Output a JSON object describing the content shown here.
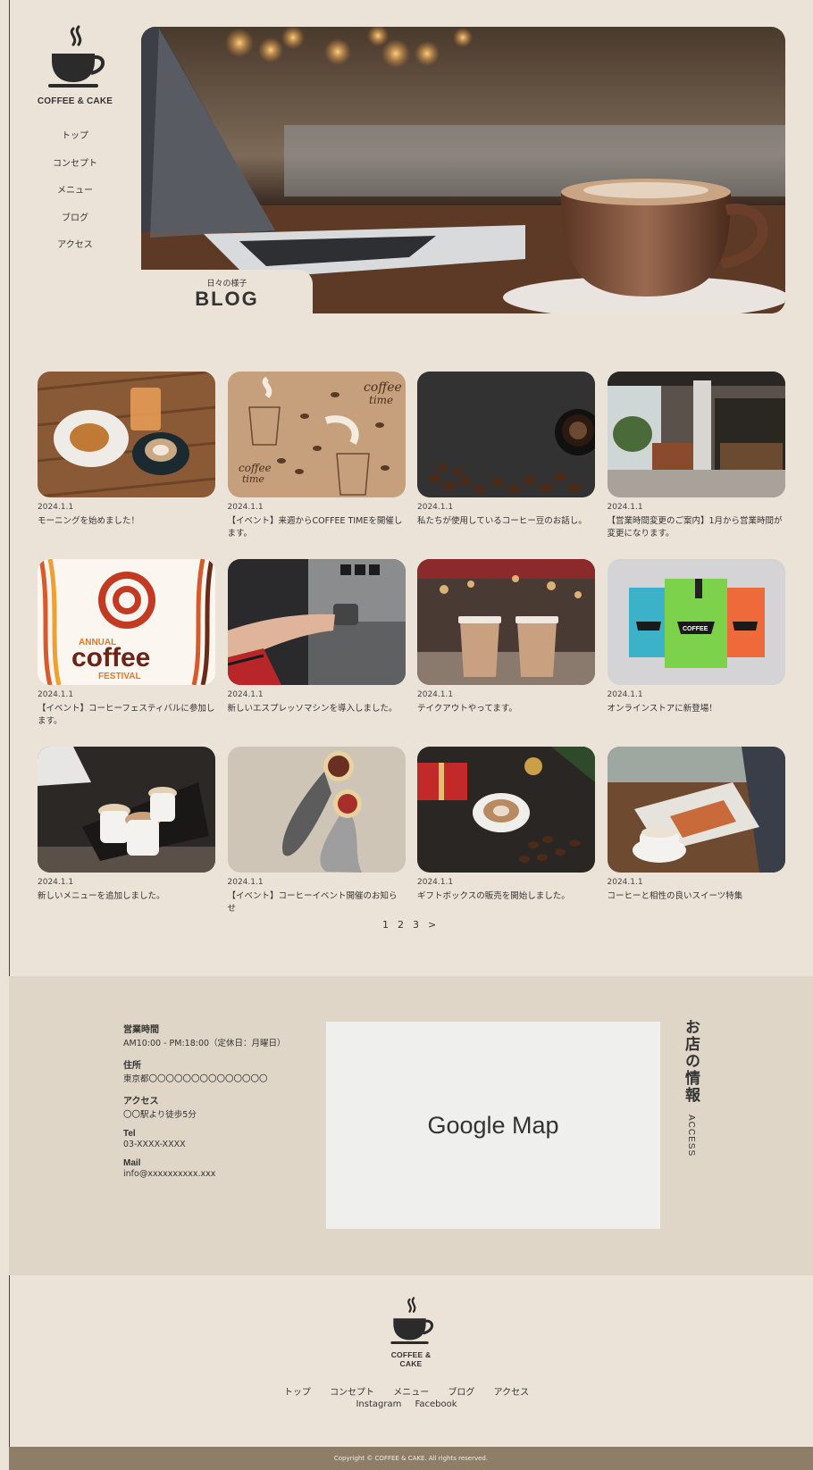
{
  "brand": {
    "name": "COFFEE & CAKE",
    "logo_icon": "coffee-cup-icon"
  },
  "sidebar": {
    "items": [
      {
        "label": "トップ"
      },
      {
        "label": "コンセプト"
      },
      {
        "label": "メニュー"
      },
      {
        "label": "ブログ"
      },
      {
        "label": "アクセス"
      }
    ]
  },
  "hero": {
    "subtitle": "日々の様子",
    "title": "BLOG"
  },
  "posts": [
    {
      "date": "2024.1.1",
      "title": "モーニングを始めました！"
    },
    {
      "date": "2024.1.1",
      "title": "【イベント】来週からCOFFEE TIMEを開催します。"
    },
    {
      "date": "2024.1.1",
      "title": "私たちが使用しているコーヒー豆のお話し。"
    },
    {
      "date": "2024.1.1",
      "title": "【営業時間変更のご案内】1月から営業時間が変更になります。"
    },
    {
      "date": "2024.1.1",
      "title": "【イベント】コーヒーフェスティバルに参加します。"
    },
    {
      "date": "2024.1.1",
      "title": "新しいエスプレッソマシンを導入しました。"
    },
    {
      "date": "2024.1.1",
      "title": "テイクアウトやってます。"
    },
    {
      "date": "2024.1.1",
      "title": "オンラインストアに新登場！"
    },
    {
      "date": "2024.1.1",
      "title": "新しいメニューを追加しました。"
    },
    {
      "date": "2024.1.1",
      "title": "【イベント】コーヒーイベント開催のお知らせ"
    },
    {
      "date": "2024.1.1",
      "title": "ギフトボックスの販売を開始しました。"
    },
    {
      "date": "2024.1.1",
      "title": "コーヒーと相性の良いスイーツ特集"
    }
  ],
  "thumb_text": {
    "coffee_time_a": "coffee",
    "coffee_time_b": "time",
    "festival_annual": "ANNUAL",
    "festival_coffee": "coffee",
    "festival_word": "FESTIVAL",
    "bag_label": "COFFEE"
  },
  "pagination": {
    "pages": [
      "1",
      "2",
      "3"
    ],
    "next": ">"
  },
  "info": {
    "heading": "お店の情報",
    "heading_en": "ACCESS",
    "hours_label": "営業時間",
    "hours_value": "AM10:00 - PM:18:00（定休日：月曜日）",
    "address_label": "住所",
    "address_value": "東京都〇〇〇〇〇〇〇〇〇〇〇〇〇〇",
    "access_label": "アクセス",
    "access_value": "〇〇駅より徒歩5分",
    "tel_label": "Tel",
    "tel_value": "03-XXXX-XXXX",
    "mail_label": "Mail",
    "mail_value": "info@xxxxxxxxxx.xxx",
    "map_text": "Google Map"
  },
  "footer": {
    "nav": [
      {
        "label": "トップ"
      },
      {
        "label": "コンセプト"
      },
      {
        "label": "メニュー"
      },
      {
        "label": "ブログ"
      },
      {
        "label": "アクセス"
      }
    ],
    "social": [
      {
        "label": "Instagram"
      },
      {
        "label": "Facebook"
      }
    ],
    "copyright": "Copyright © COFFEE & CAKE. All rights reserved."
  },
  "colors": {
    "background": "#ece3d8",
    "info_bg": "#e0d6c7",
    "footer_bar": "#8e7e67",
    "text": "#333333"
  }
}
